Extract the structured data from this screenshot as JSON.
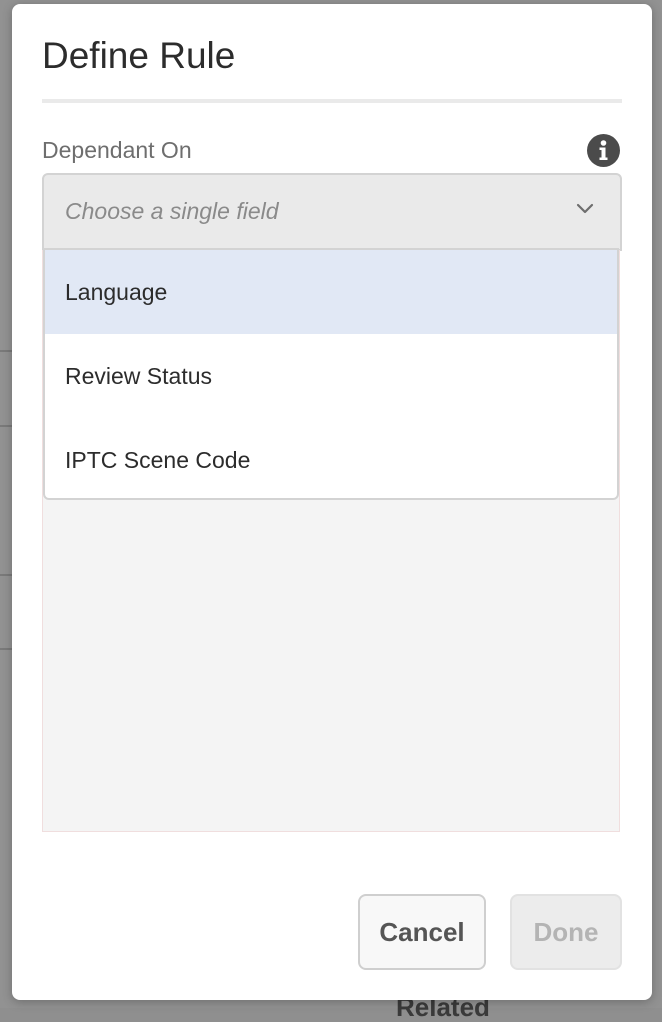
{
  "background": {
    "peek_text": "Related"
  },
  "dialog": {
    "title": "Define Rule",
    "field": {
      "label": "Dependant On",
      "placeholder": "Choose a single field",
      "info_icon": "info-icon",
      "chevron_icon": "chevron-down-icon"
    },
    "dropdown": {
      "items": [
        {
          "label": "Language",
          "highlighted": true
        },
        {
          "label": "Review Status",
          "highlighted": false
        },
        {
          "label": "IPTC Scene Code",
          "highlighted": false
        }
      ]
    },
    "buttons": {
      "cancel_label": "Cancel",
      "done_label": "Done",
      "done_enabled": false
    }
  },
  "colors": {
    "highlight": "#e1e8f5",
    "select_bg": "#eaeaea",
    "content_bg": "#f4f4f4",
    "disabled_text": "#b4b4b4"
  }
}
